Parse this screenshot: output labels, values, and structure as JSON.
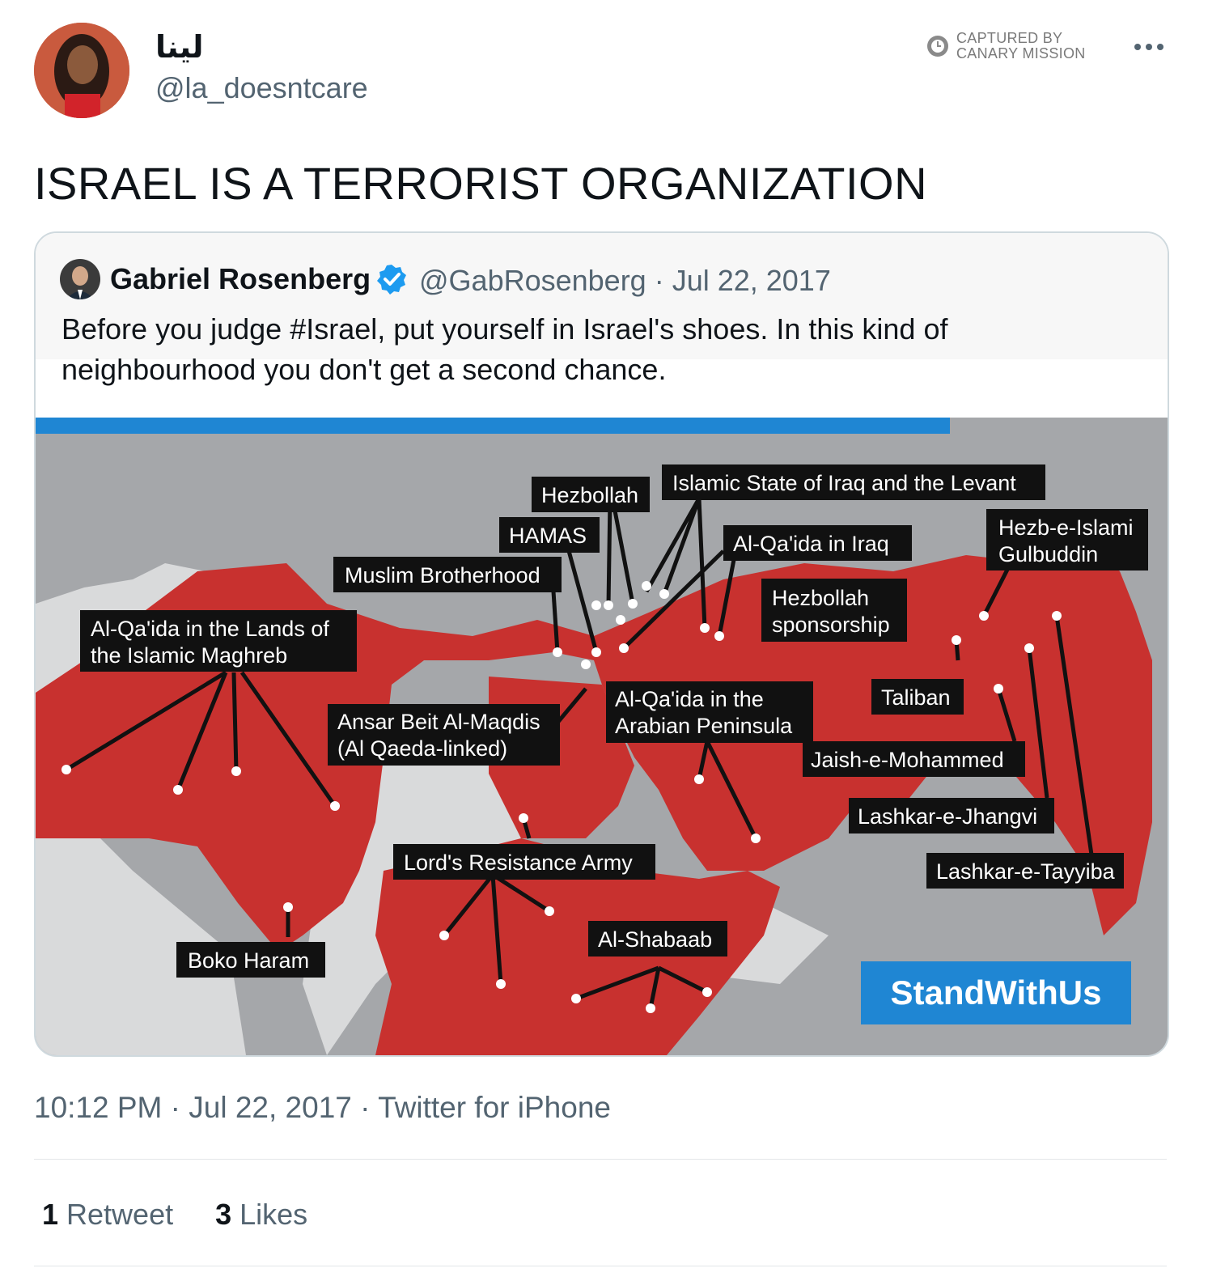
{
  "author": {
    "display_name": "لينا",
    "handle": "@la_doesntcare"
  },
  "watermark": {
    "line1": "CAPTURED BY",
    "line2": "CANARY MISSION"
  },
  "menu_icon": "more-horizontal-icon",
  "tweet_text": "ISRAEL IS A TERRORIST ORGANIZATION",
  "quoted_tweet": {
    "display_name": "Gabriel Rosenberg",
    "verified": true,
    "meta": "@GabRosenberg · Jul 22, 2017",
    "text": "Before you judge #Israel, put yourself in Israel's shoes. In this kind of neighbourhood you don't get a second chance.",
    "image": {
      "brand": "StandWithUs",
      "labels": [
        "Hezbollah",
        "Islamic State of Iraq and the Levant",
        "HAMAS",
        "Al-Qa'ida in Iraq",
        "Hezb-e-Islami",
        "Gulbuddin",
        "Muslim Brotherhood",
        "Hezbollah",
        "sponsorship",
        "Al-Qa'ida in the Lands of",
        "the Islamic Maghreb",
        "Al-Qa'ida in the",
        "Arabian Peninsula",
        "Taliban",
        "Ansar Beit Al-Maqdis",
        "(Al Qaeda-linked)",
        "Jaish-e-Mohammed",
        "Lashkar-e-Jhangvi",
        "Lord's Resistance Army",
        "Lashkar-e-Tayyiba",
        "Al-Shabaab",
        "Boko Haram"
      ]
    }
  },
  "timestamp": "10:12 PM · Jul 22, 2017 · Twitter for iPhone",
  "stats": {
    "retweets_count": "1",
    "retweets_label": "Retweet",
    "likes_count": "3",
    "likes_label": "Likes"
  },
  "colors": {
    "map_red": "#c8312f",
    "map_gray": "#a5a7aa",
    "map_light": "#d9dadb",
    "brand_blue": "#1f86d3",
    "verified_blue": "#1d9bf0"
  }
}
